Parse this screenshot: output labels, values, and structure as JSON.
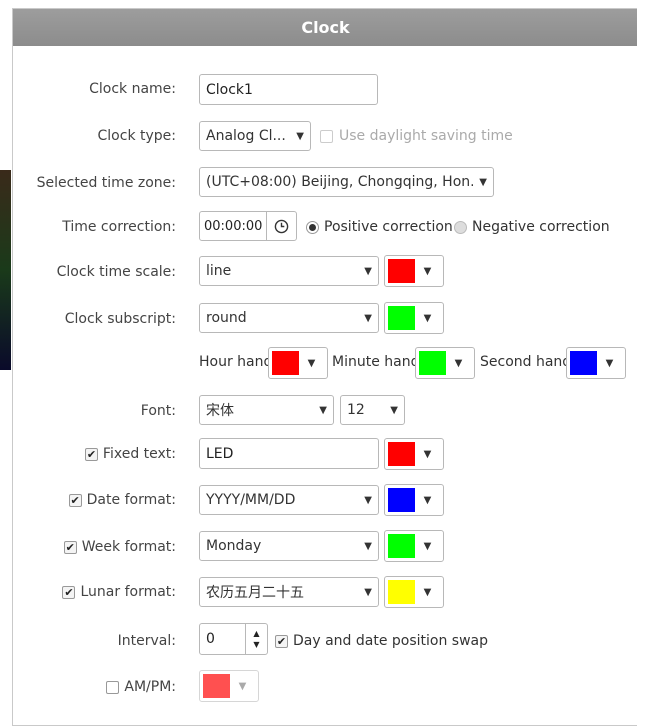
{
  "dialog": {
    "title": "Clock"
  },
  "clock_name": {
    "label": "Clock name:",
    "value": "Clock1"
  },
  "clock_type": {
    "label": "Clock type:",
    "value": "Analog Cl...",
    "daylight_label": "Use daylight saving time",
    "daylight_checked": false
  },
  "time_zone": {
    "label": "Selected time zone:",
    "value": "(UTC+08:00) Beijing, Chongqing, Hon..."
  },
  "time_correction": {
    "label": "Time correction:",
    "value": "00:00:00",
    "positive_label": "Positive correction",
    "negative_label": "Negative correction",
    "selected": "positive"
  },
  "time_scale": {
    "label": "Clock time scale:",
    "value": "line",
    "color": "#ff0000"
  },
  "subscript": {
    "label": "Clock subscript:",
    "value": "round",
    "color": "#00ff00"
  },
  "hands": {
    "hour_label": "Hour hand",
    "hour_color": "#ff0000",
    "minute_label": "Minute hand",
    "minute_color": "#00ff00",
    "second_label": "Second hand",
    "second_color": "#0000ff"
  },
  "font": {
    "label": "Font:",
    "family": "宋体",
    "size": "12"
  },
  "fixed_text": {
    "label": "Fixed text:",
    "checked": true,
    "value": "LED",
    "color": "#ff0000"
  },
  "date_format": {
    "label": "Date format:",
    "checked": true,
    "value": "YYYY/MM/DD",
    "color": "#0000ff"
  },
  "week_format": {
    "label": "Week format:",
    "checked": true,
    "value": "Monday",
    "color": "#00ff00"
  },
  "lunar_format": {
    "label": "Lunar format:",
    "checked": true,
    "value": "农历五月二十五",
    "color": "#ffff00"
  },
  "interval": {
    "label": "Interval:",
    "value": "0",
    "swap_label": "Day and date position swap",
    "swap_checked": true
  },
  "ampm": {
    "label": "AM/PM:",
    "checked": false,
    "color": "#ff5050"
  },
  "icons": {
    "clock": "clock-icon",
    "caret": "▾",
    "check": "✔",
    "spin_up": "▲",
    "spin_down": "▼"
  }
}
